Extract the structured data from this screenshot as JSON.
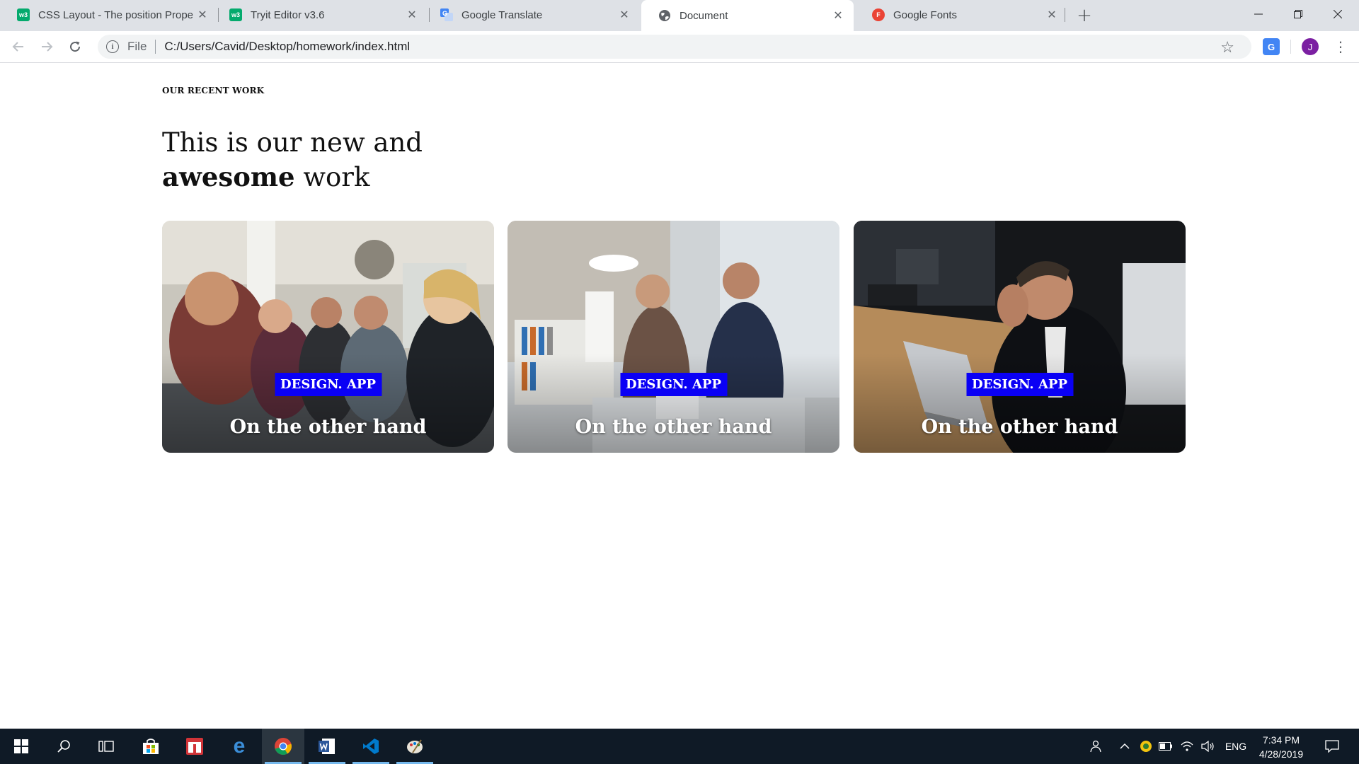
{
  "browser": {
    "tabs": [
      {
        "title": "CSS Layout - The position Proper",
        "favicon": "w3schools-favicon",
        "active": false
      },
      {
        "title": "Tryit Editor v3.6",
        "favicon": "w3schools-favicon",
        "active": false
      },
      {
        "title": "Google Translate",
        "favicon": "google-translate-favicon",
        "active": false
      },
      {
        "title": "Document",
        "favicon": "globe-favicon",
        "active": true
      },
      {
        "title": "Google Fonts",
        "favicon": "google-fonts-favicon",
        "active": false
      }
    ],
    "address": {
      "scheme_label": "File",
      "url": "C:/Users/Cavid/Desktop/homework/index.html"
    },
    "profile_initial": "J",
    "favicon_texts": {
      "w3": "w3",
      "fonts": "F"
    },
    "translate_glyph": "G"
  },
  "page": {
    "eyebrow": "OUR RECENT WORK",
    "headline_line1": "This is our new and",
    "headline_bold": "awesome",
    "headline_rest": " work",
    "cards": [
      {
        "badge": "DESIGN. APP",
        "caption": "On the other hand",
        "image": "team-meeting-photo"
      },
      {
        "badge": "DESIGN. APP",
        "caption": "On the other hand",
        "image": "handshake-office-photo"
      },
      {
        "badge": "DESIGN. APP",
        "caption": "On the other hand",
        "image": "stressed-man-laptop-photo"
      }
    ]
  },
  "taskbar": {
    "tray": {
      "language": "ENG"
    },
    "clock": {
      "time": "7:34 PM",
      "date": "4/28/2019"
    }
  },
  "colors": {
    "badge": "#0a00f5",
    "taskbar": "#0f1a26",
    "tab_strip": "#dee1e6"
  }
}
